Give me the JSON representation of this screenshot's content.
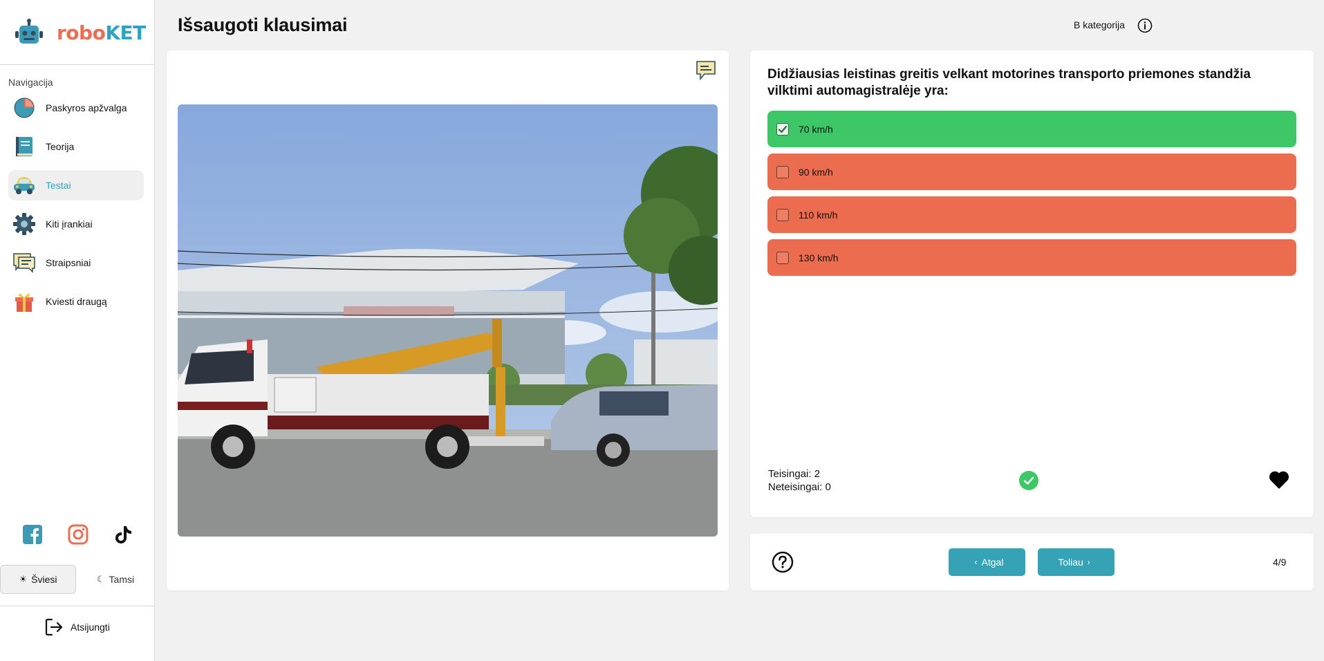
{
  "brand": {
    "robo": "robo",
    "ket": "KET"
  },
  "nav": {
    "title": "Navigacija",
    "items": [
      {
        "label": "Paskyros apžvalga",
        "icon": "pie-chart-icon",
        "active": false
      },
      {
        "label": "Teorija",
        "icon": "book-icon",
        "active": false
      },
      {
        "label": "Testai",
        "icon": "car-icon",
        "active": true
      },
      {
        "label": "Kiti įrankiai",
        "icon": "gear-icon",
        "active": false
      },
      {
        "label": "Straipsniai",
        "icon": "chat-bubbles-icon",
        "active": false
      },
      {
        "label": "Kviesti draugą",
        "icon": "gift-icon",
        "active": false
      }
    ]
  },
  "social": [
    "facebook-icon",
    "instagram-icon",
    "tiktok-icon"
  ],
  "theme": {
    "light": "Šviesi",
    "dark": "Tamsi",
    "selected": "light"
  },
  "logout": "Atsijungti",
  "header": {
    "title": "Išsaugoti klausimai",
    "category": "B kategorija"
  },
  "question": {
    "text": "Didžiausias leistinas greitis velkant motorines transporto priemones standžia vilktimi automagistralėje yra:",
    "answers": [
      {
        "label": "70 km/h",
        "state": "correct",
        "checked": true
      },
      {
        "label": "90 km/h",
        "state": "wrong",
        "checked": false
      },
      {
        "label": "110 km/h",
        "state": "wrong",
        "checked": false
      },
      {
        "label": "130 km/h",
        "state": "wrong",
        "checked": false
      }
    ]
  },
  "stats": {
    "correct": "Teisingai: 2",
    "incorrect": "Neteisingai: 0"
  },
  "navigation": {
    "back": "Atgal",
    "next": "Toliau",
    "counter": "4/9"
  },
  "colors": {
    "accent": "#35a2b6",
    "correct": "#3dc766",
    "wrong": "#ec6c4f",
    "brand_red": "#ee6c52",
    "brand_blue": "#2fa4c0"
  }
}
